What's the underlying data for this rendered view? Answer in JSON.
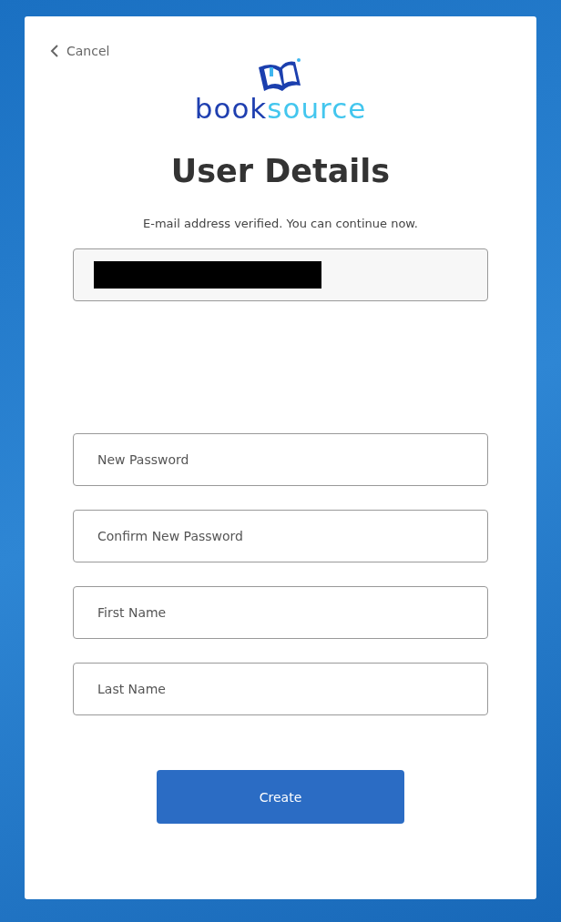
{
  "cancel": {
    "label": "Cancel"
  },
  "logo": {
    "primary": "book",
    "secondary": "source"
  },
  "title": "User Details",
  "message": "E-mail address verified. You can continue now.",
  "fields": [
    {
      "placeholder": "New Password"
    },
    {
      "placeholder": "Confirm New Password"
    },
    {
      "placeholder": "First Name"
    },
    {
      "placeholder": "Last Name"
    }
  ],
  "submit": {
    "label": "Create"
  }
}
